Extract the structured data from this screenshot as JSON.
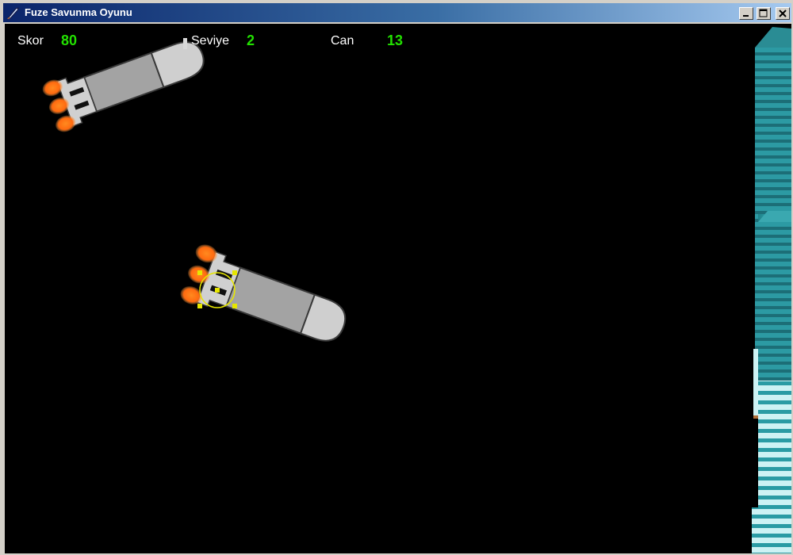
{
  "window": {
    "title": "Fuze Savunma Oyunu",
    "icon": "missile-icon",
    "controls": [
      "minimize-icon",
      "maximize-icon",
      "close-icon"
    ]
  },
  "hud": {
    "score_label": "Skor",
    "score_value": "80",
    "level_label": "Seviye",
    "level_value": "2",
    "health_label": "Can",
    "health_value": "13"
  },
  "colors": {
    "background": "#000000",
    "hud_value": "#22e000",
    "missile_body": "#a3a3a3",
    "missile_nose": "#cfcfcf",
    "flame": "#ff7a1f",
    "building": "#2e9ea6",
    "crosshair": "#e6e600"
  }
}
